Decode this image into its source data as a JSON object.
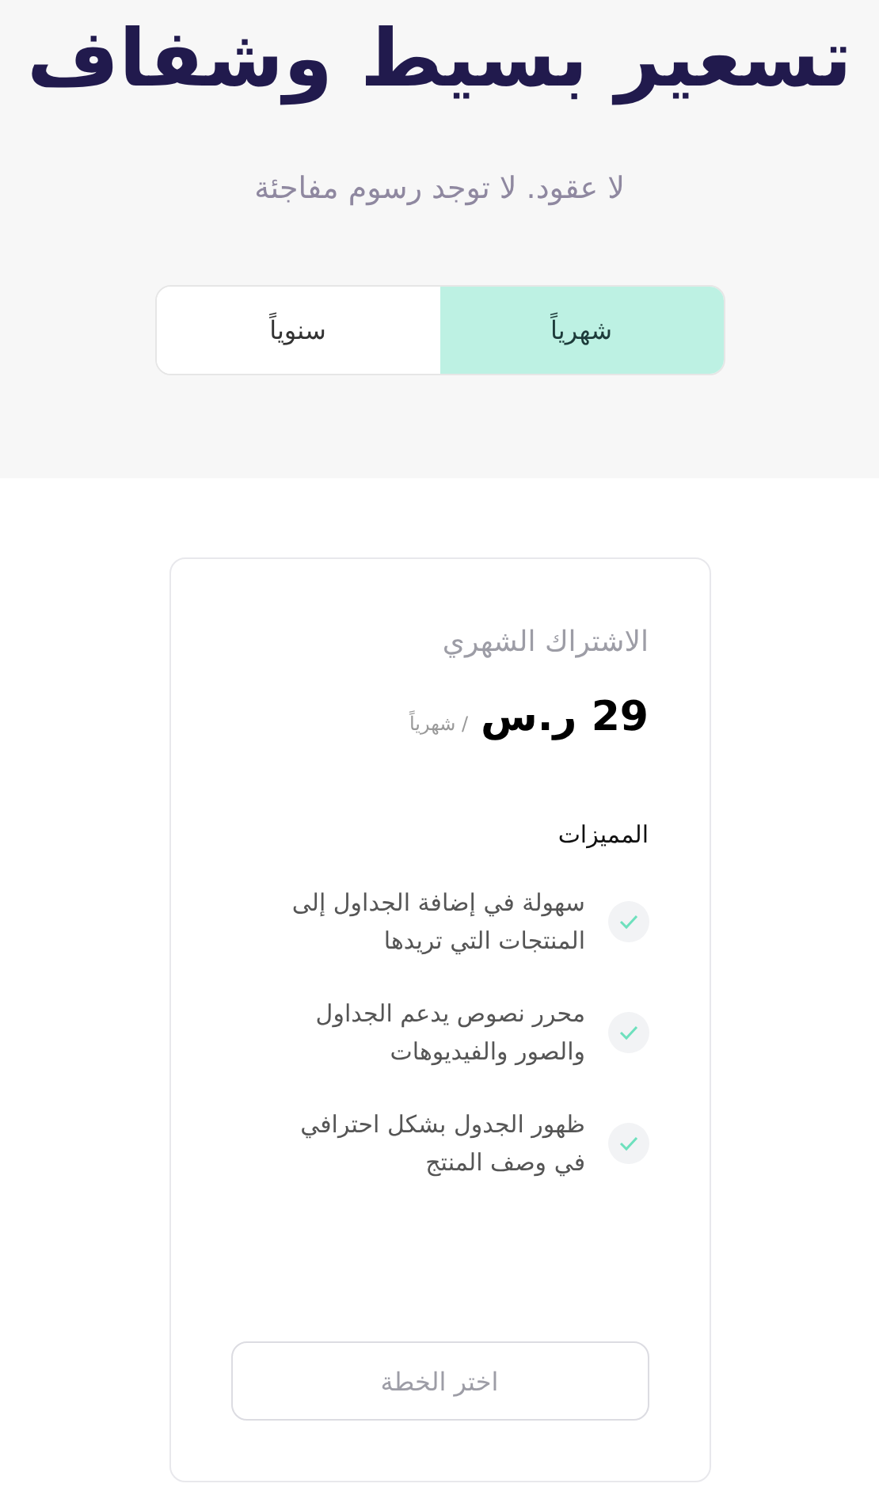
{
  "header": {
    "title": "تسعير بسيط وشفاف",
    "subtitle": "لا عقود. لا توجد رسوم مفاجئة"
  },
  "billing_tabs": [
    {
      "label": "شهرياً",
      "selected": true
    },
    {
      "label": "سنوياً",
      "selected": false
    }
  ],
  "plan": {
    "name": "الاشتراك الشهري",
    "price": "29 ر.س",
    "period": "/ شهرياً",
    "features_heading": "المميزات",
    "features": [
      {
        "text": "سهولة في إضافة الجداول إلى المنتجات التي تريدها"
      },
      {
        "text": "محرر نصوص يدعم الجداول والصور والفيديوهات"
      },
      {
        "text": "ظهور الجدول بشكل احترافي في وصف المنتج"
      }
    ],
    "button": {
      "label": "اختر الخطة",
      "disabled": true
    }
  }
}
